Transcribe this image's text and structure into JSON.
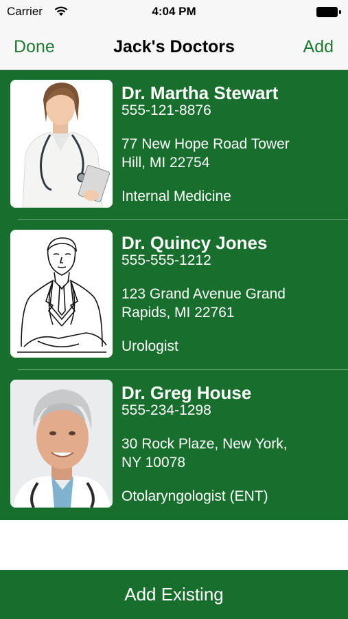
{
  "status_bar": {
    "carrier": "Carrier",
    "time": "4:04 PM"
  },
  "nav": {
    "left_label": "Done",
    "title": "Jack's Doctors",
    "right_label": "Add"
  },
  "doctors": [
    {
      "name": "Dr. Martha Stewart",
      "phone": "555-121-8876",
      "address_line1": "77 New Hope Road Tower",
      "address_line2": "Hill, MI 22754",
      "specialty": "Internal Medicine"
    },
    {
      "name": "Dr. Quincy Jones",
      "phone": "555-555-1212",
      "address_line1": "123 Grand Avenue Grand",
      "address_line2": "Rapids, MI 22761",
      "specialty": "Urologist"
    },
    {
      "name": "Dr. Greg House",
      "phone": "555-234-1298",
      "address_line1": "30 Rock Plaze, New York,",
      "address_line2": "NY  10078",
      "specialty": "Otolaryngologist (ENT)"
    }
  ],
  "bottom_button": {
    "label": "Add Existing"
  },
  "colors": {
    "accent": "#1e7a33",
    "list_background": "#186e2c",
    "text_on_green": "#ffffff"
  }
}
